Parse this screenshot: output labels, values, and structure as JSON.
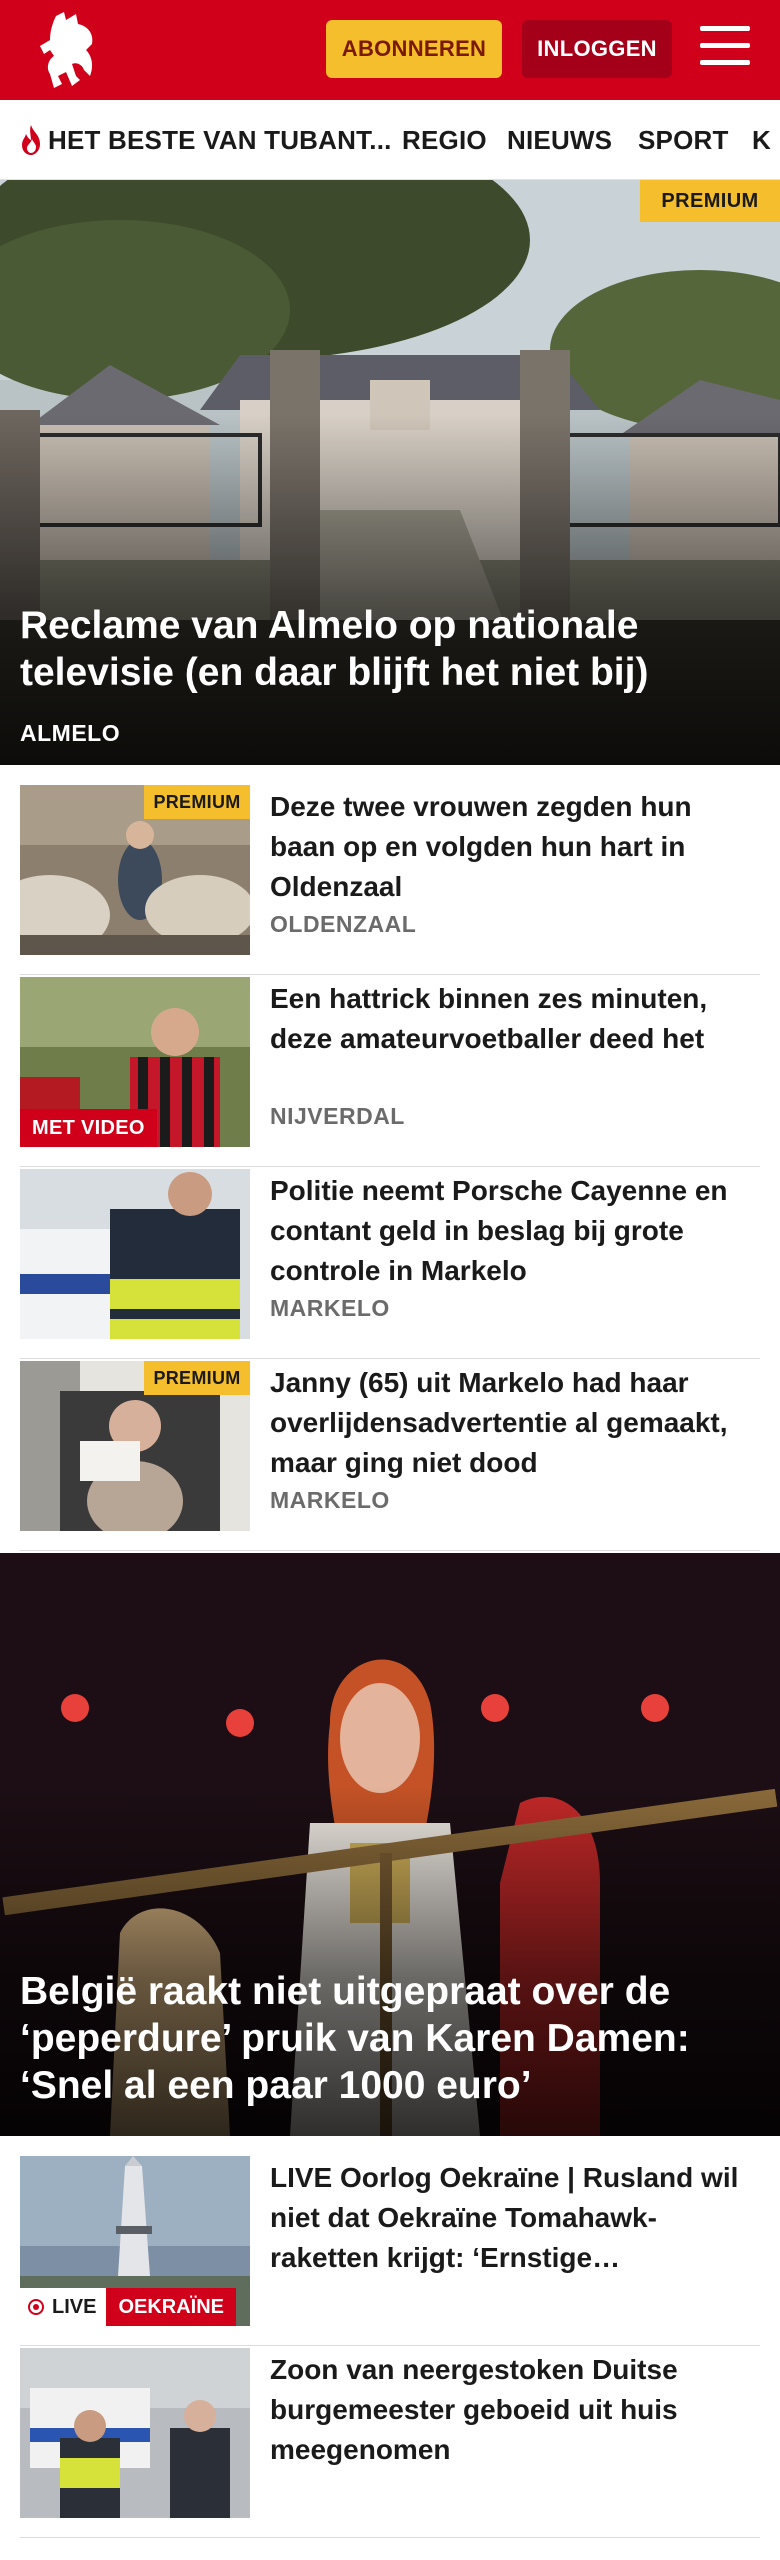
{
  "header": {
    "subscribe_label": "ABONNEREN",
    "login_label": "INLOGGEN",
    "brand_color": "#d0001b",
    "accent_color": "#f4be2c"
  },
  "nav": {
    "items": [
      {
        "label": "HET BESTE VAN TUBANT...",
        "icon": "flame-icon"
      },
      {
        "label": "REGIO"
      },
      {
        "label": "NIEUWS"
      },
      {
        "label": "SPORT"
      },
      {
        "label": "K"
      }
    ]
  },
  "hero1": {
    "badge": "PREMIUM",
    "title": "Reclame van Almelo op nationale televisie (en daar blijft het niet bij)",
    "kicker": "ALMELO"
  },
  "articles": [
    {
      "badge": "PREMIUM",
      "title": "Deze twee vrouwen zegden hun baan op en volgden hun hart in Oldenzaal",
      "kicker": "OLDENZAAL"
    },
    {
      "video_label": "MET VIDEO",
      "title": "Een hattrick binnen zes minuten, deze amateurvoetballer deed het",
      "kicker": "NIJVERDAL"
    },
    {
      "title": "Politie neemt Porsche Cayenne en contant geld in beslag bij grote controle in Markelo",
      "kicker": "MARKELO"
    },
    {
      "badge": "PREMIUM",
      "title": "Janny (65) uit Markelo had haar overlijdensadvertentie al gemaakt, maar ging niet dood",
      "kicker": "MARKELO"
    }
  ],
  "hero2": {
    "title": "België raakt niet uitgepraat over de ‘peperdure’ pruik van Karen Damen: ‘Snel al een paar 1000 euro’"
  },
  "articles2": [
    {
      "live_label": "LIVE",
      "tag_label": "OEKRAÏNE",
      "title": "LIVE Oorlog Oekraïne | Rusland wil niet dat Oekraïne Tomahawk-raketten krijgt: ‘Ernstige…",
      "kicker": ""
    },
    {
      "title": "Zoon van neergestoken Duitse burgemeester geboeid uit huis meegenomen",
      "kicker": ""
    }
  ]
}
